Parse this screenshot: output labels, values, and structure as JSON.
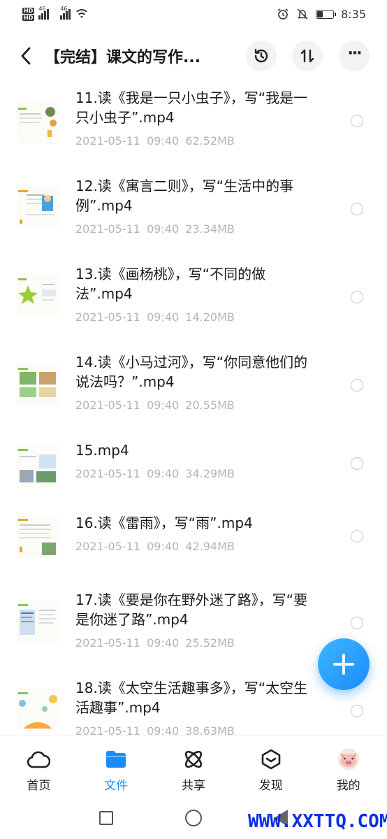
{
  "status_bar": {
    "hd1": "HD",
    "hd2": "HD",
    "net1": "46",
    "net2": "46",
    "time": "8:35"
  },
  "header": {
    "title": "【完结】课文的写作...",
    "icons": [
      "history-icon",
      "sort-icon",
      "more-icon"
    ],
    "more_label": "···"
  },
  "files": [
    {
      "name": "11.读《我是一只小虫子》，写“我是一只小虫子”.mp4",
      "date": "2021-05-11",
      "time": "09:40",
      "size": "62.52MB"
    },
    {
      "name": "12.读《寓言二则》，写“生活中的事例”.mp4",
      "date": "2021-05-11",
      "time": "09:40",
      "size": "23.34MB"
    },
    {
      "name": "13.读《画杨桃》，写“不同的做法”.mp4",
      "date": "2021-05-11",
      "time": "09:40",
      "size": "14.20MB"
    },
    {
      "name": "14.读《小马过河》，写“你同意他们的说法吗？”.mp4",
      "date": "2021-05-11",
      "time": "09:40",
      "size": "20.55MB"
    },
    {
      "name": "15.mp4",
      "date": "2021-05-11",
      "time": "09:40",
      "size": "34.29MB"
    },
    {
      "name": "16.读《雷雨》，写“雨”.mp4",
      "date": "2021-05-11",
      "time": "09:40",
      "size": "42.94MB"
    },
    {
      "name": "17.读《要是你在野外迷了路》，写“要是你迷了路”.mp4",
      "date": "2021-05-11",
      "time": "09:40",
      "size": "25.52MB"
    },
    {
      "name": "18.读《太空生活趣事多》，写“太空生活趣事”.mp4",
      "date": "2021-05-11",
      "time": "09:40",
      "size": "38.63MB"
    }
  ],
  "nav": {
    "items": [
      {
        "label": "首页",
        "icon": "cloud-home-icon"
      },
      {
        "label": "文件",
        "icon": "folder-icon",
        "active": true
      },
      {
        "label": "共享",
        "icon": "atom-share-icon"
      },
      {
        "label": "发现",
        "icon": "discover-box-icon"
      },
      {
        "label": "我的",
        "icon": "pig-avatar-icon"
      }
    ]
  },
  "watermark": "WWW.XXTTQ.COM",
  "colors": {
    "accent": "#1a8cff",
    "meta_text": "#b2b4b8",
    "button_bg": "#f2f3f5"
  },
  "battery_level": 0.35
}
